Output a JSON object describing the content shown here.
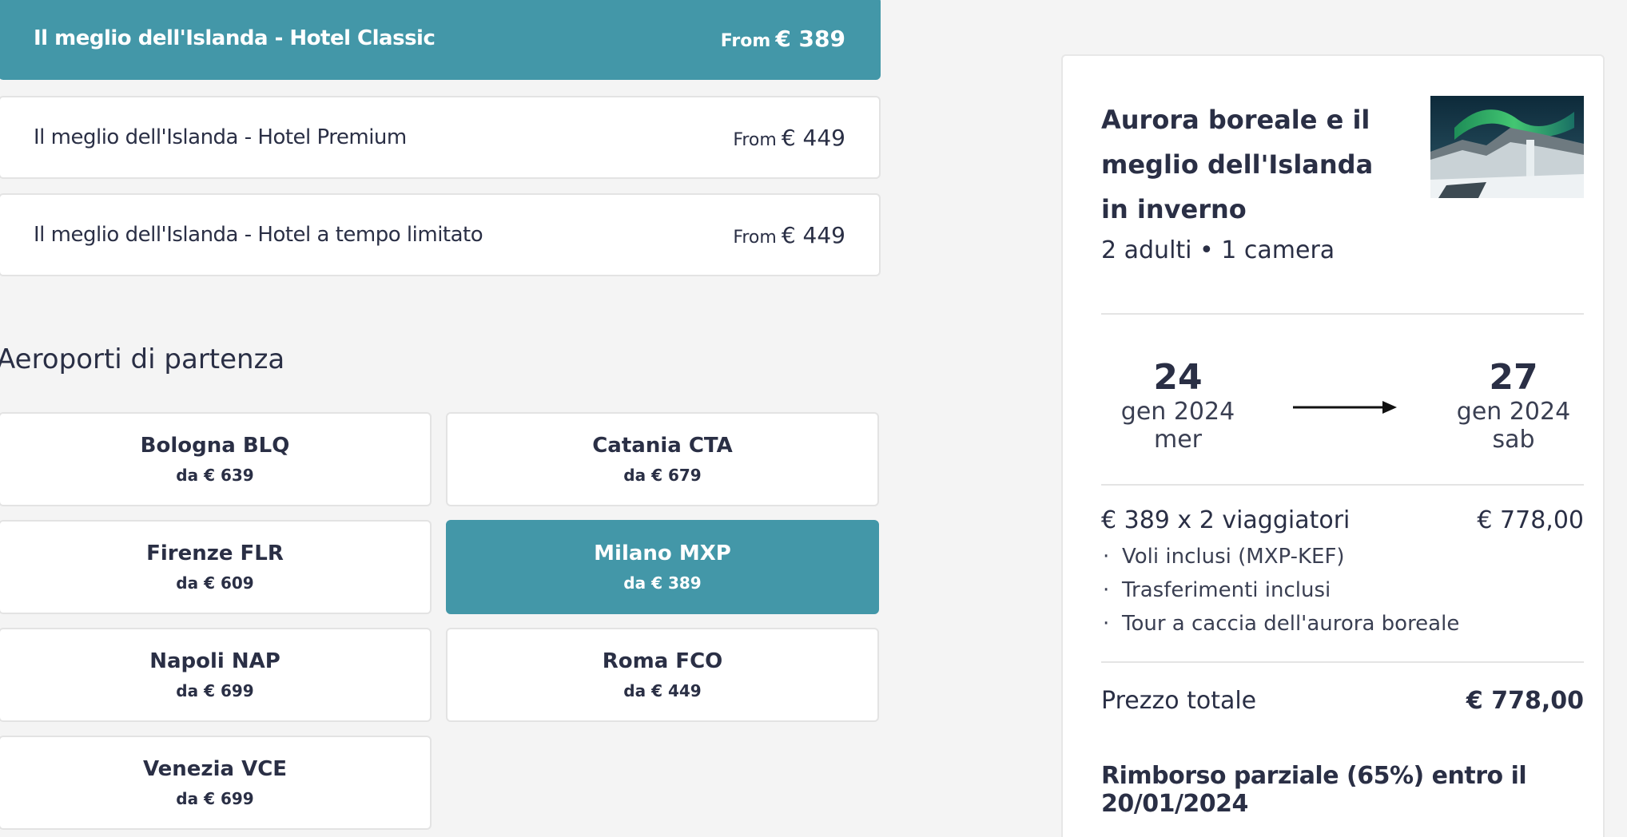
{
  "hotel_options": [
    {
      "name": "Il meglio dell'Islanda - Hotel Classic",
      "from_label": "From",
      "price": "€ 389",
      "selected": true
    },
    {
      "name": "Il meglio dell'Islanda - Hotel Premium",
      "from_label": "From",
      "price": "€ 449",
      "selected": false
    },
    {
      "name": "Il meglio dell'Islanda - Hotel a tempo limitato",
      "from_label": "From",
      "price": "€ 449",
      "selected": false
    }
  ],
  "airports_section": {
    "heading": "Aeroporti di partenza",
    "airports": [
      {
        "name": "Bologna BLQ",
        "price": "da € 639",
        "selected": false
      },
      {
        "name": "Catania CTA",
        "price": "da € 679",
        "selected": false
      },
      {
        "name": "Firenze FLR",
        "price": "da € 609",
        "selected": false
      },
      {
        "name": "Milano MXP",
        "price": "da € 389",
        "selected": true
      },
      {
        "name": "Napoli NAP",
        "price": "da € 699",
        "selected": false
      },
      {
        "name": "Roma FCO",
        "price": "da € 449",
        "selected": false
      },
      {
        "name": "Venezia VCE",
        "price": "da € 699",
        "selected": false
      }
    ]
  },
  "summary": {
    "title": "Aurora boreale e il meglio dell'Islanda in inverno",
    "guests": "2 adulti • 1 camera",
    "image": "waterfall-northern-lights-photo",
    "departure": {
      "day": "24",
      "month": "gen 2024",
      "weekday": "mer"
    },
    "return": {
      "day": "27",
      "month": "gen 2024",
      "weekday": "sab"
    },
    "arrow_icon": "arrow-right-icon",
    "price_line": {
      "desc": "€ 389 x 2 viaggiatori",
      "value": "€ 778,00"
    },
    "inclusions": [
      "Voli inclusi (MXP-KEF)",
      "Trasferimenti inclusi",
      "Tour a caccia dell'aurora boreale"
    ],
    "bullet_char": "·",
    "total": {
      "label": "Prezzo totale",
      "value": "€ 778,00"
    },
    "refund": "Rimborso parziale (65%) entro il 20/01/2024"
  },
  "colors": {
    "accent": "#4397a8",
    "text": "#2a2f45",
    "background": "#f4f4f4",
    "card": "#ffffff"
  }
}
